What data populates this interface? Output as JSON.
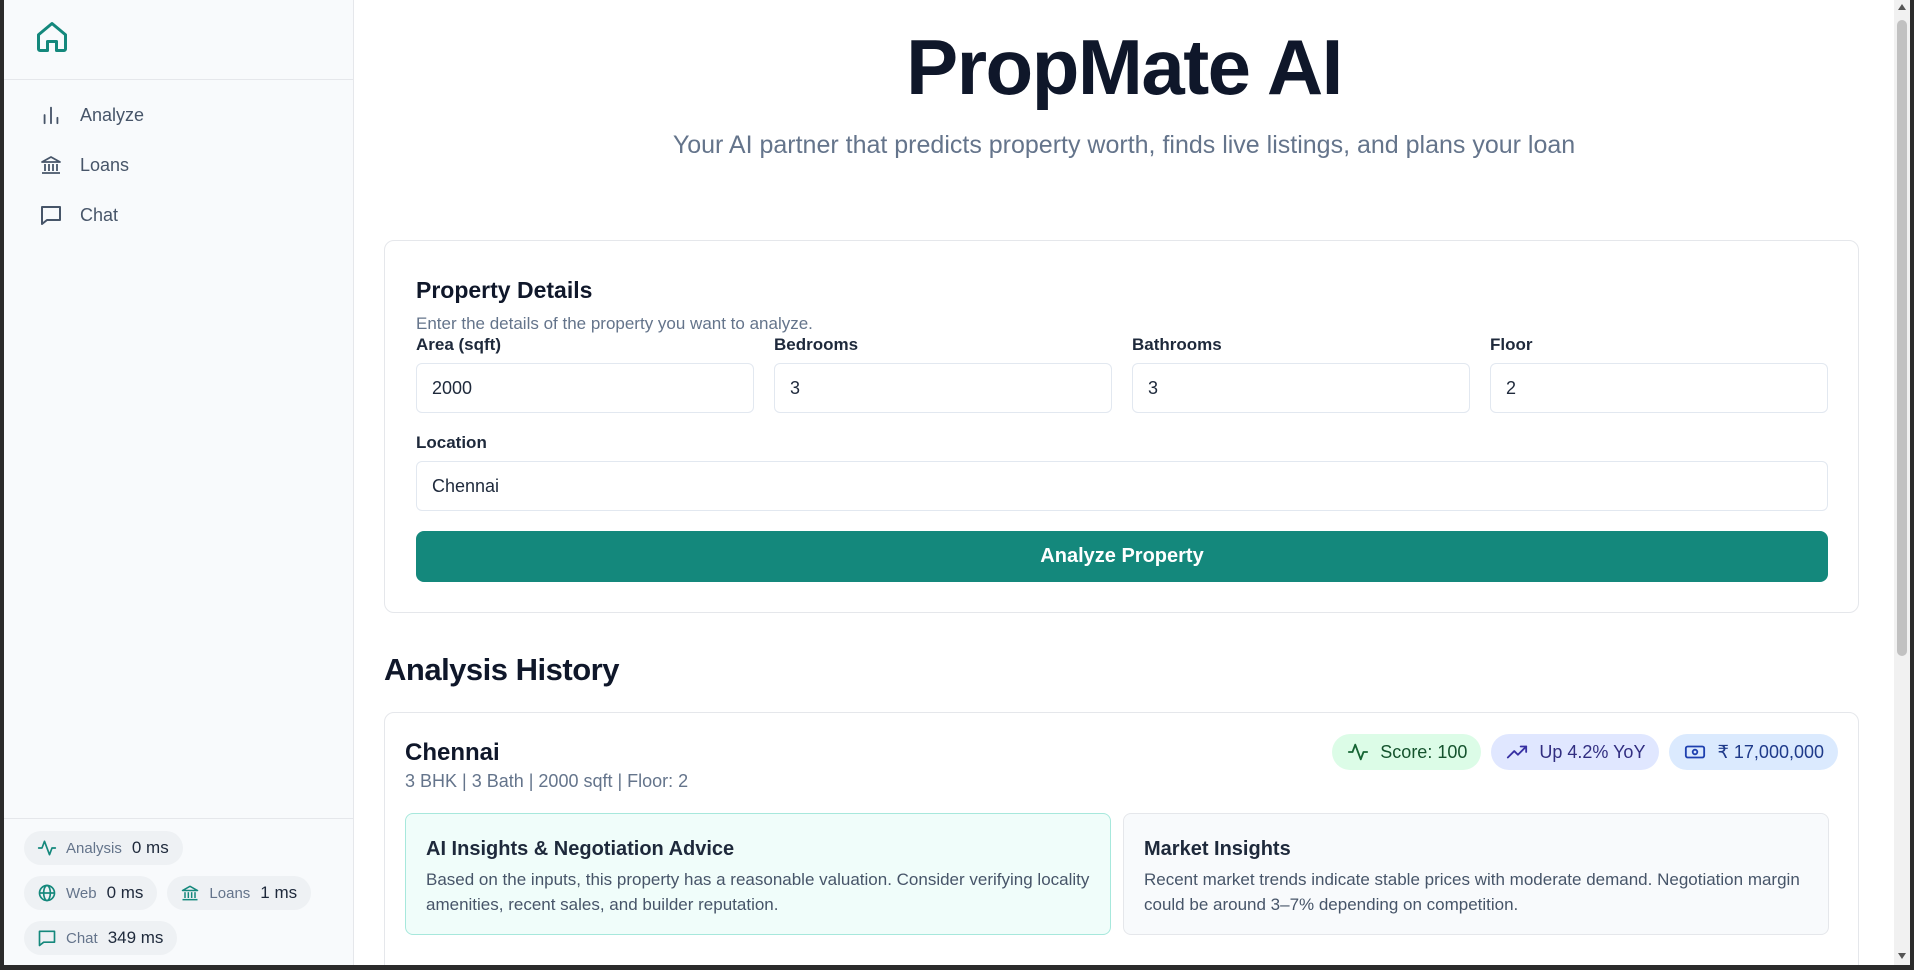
{
  "app": {
    "title": "PropMate AI",
    "subtitle": "Your AI partner that predicts property worth, finds live listings, and plans your loan",
    "brand_color": "#14887c"
  },
  "sidebar": {
    "logo_icon": "home-icon",
    "items": [
      {
        "label": "Analyze",
        "icon": "bar-chart-icon"
      },
      {
        "label": "Loans",
        "icon": "bank-icon"
      },
      {
        "label": "Chat",
        "icon": "chat-icon"
      }
    ],
    "metrics": [
      {
        "name": "Analysis",
        "value": "0 ms",
        "icon": "activity-icon"
      },
      {
        "name": "Web",
        "value": "0 ms",
        "icon": "globe-icon"
      },
      {
        "name": "Loans",
        "value": "1 ms",
        "icon": "bank-icon"
      },
      {
        "name": "Chat",
        "value": "349 ms",
        "icon": "chat-icon"
      }
    ]
  },
  "form": {
    "title": "Property Details",
    "description": "Enter the details of the property you want to analyze.",
    "area": {
      "label": "Area (sqft)",
      "value": "2000"
    },
    "bedrooms": {
      "label": "Bedrooms",
      "value": "3"
    },
    "bathrooms": {
      "label": "Bathrooms",
      "value": "3"
    },
    "floor": {
      "label": "Floor",
      "value": "2"
    },
    "location": {
      "label": "Location",
      "value": "Chennai"
    },
    "submit_label": "Analyze Property"
  },
  "history": {
    "title": "Analysis History",
    "entries": [
      {
        "location": "Chennai",
        "meta": "3 BHK | 3 Bath | 2000 sqft | Floor: 2",
        "score": "Score: 100",
        "trend": "Up 4.2% YoY",
        "price": "₹ 17,000,000",
        "ai_title": "AI Insights & Negotiation Advice",
        "ai_body": "Based on the inputs, this property has a reasonable valuation. Consider verifying locality amenities, recent sales, and builder reputation.",
        "market_title": "Market Insights",
        "market_body": "Recent market trends indicate stable prices with moderate demand. Negotiation margin could be around 3–7% depending on competition."
      }
    ]
  }
}
